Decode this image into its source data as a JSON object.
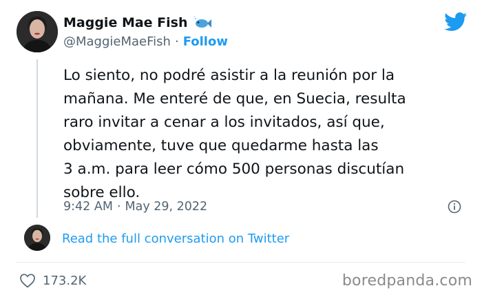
{
  "author": {
    "name": "Maggie Mae Fish",
    "handle": "@MaggieMaeFish",
    "emoji": "fish-emoji-icon",
    "follow_label": "Follow"
  },
  "tweet": {
    "text": "Lo siento, no podré asistir a la reunión por la\nmañana. Me enteré de que, en Suecia, resulta\nraro invitar a cenar a los invitados, así que,\nobviamente, tuve que quedarme hasta las\n3 a.m. para leer cómo 500 personas discutían\nsobre ello.",
    "time": "9:42 AM",
    "date": "May 29, 2022"
  },
  "read_conversation_label": "Read the full conversation on Twitter",
  "likes_count": "173.2K",
  "watermark": "boredpanda.com",
  "colors": {
    "accent": "#1d9bf0",
    "secondary_text": "#536471"
  }
}
